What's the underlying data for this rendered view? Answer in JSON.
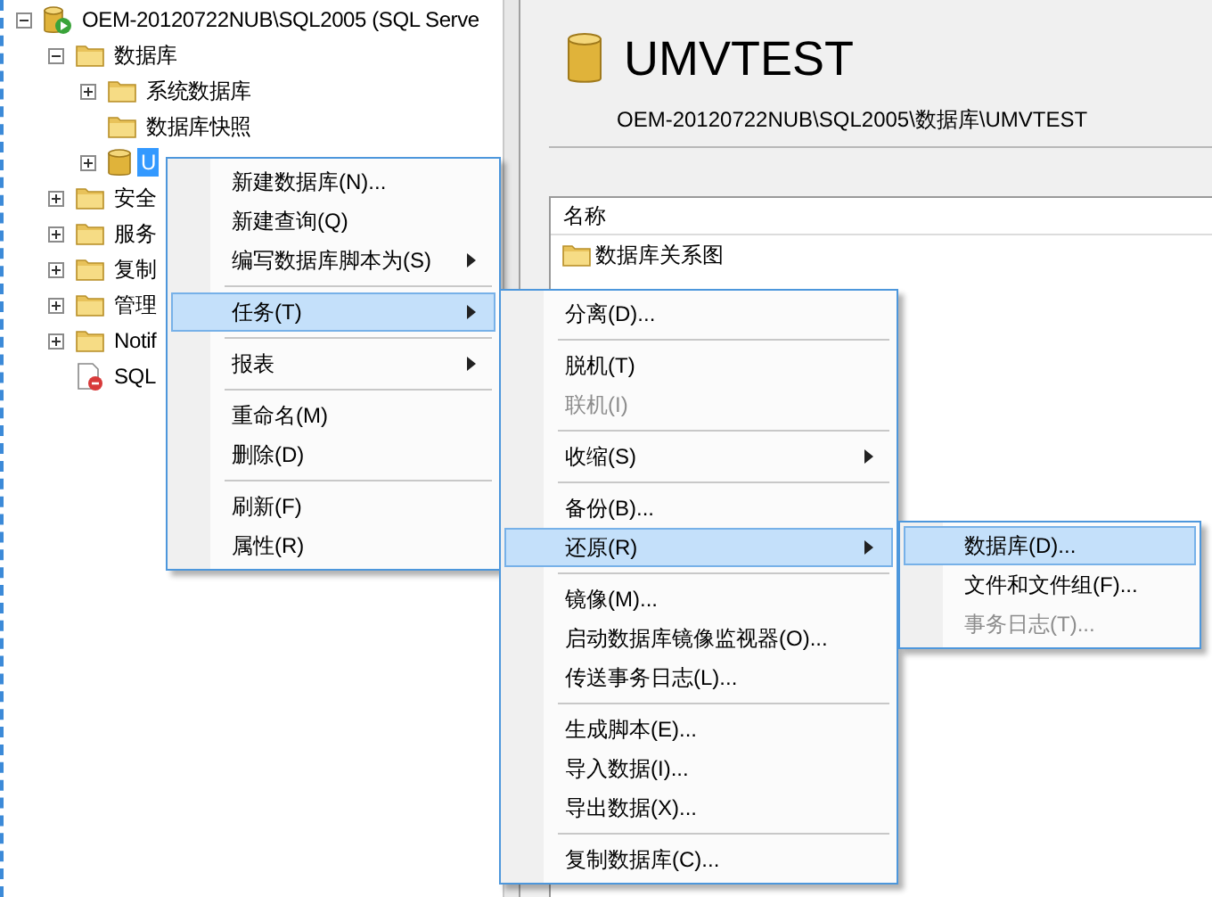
{
  "tree": [
    {
      "label": "OEM-20120722NUB\\SQL2005 (SQL Serve",
      "kind": "server",
      "expandable": true,
      "expanded": true,
      "selected": false,
      "children": [
        {
          "label": "数据库",
          "kind": "folder",
          "expandable": true,
          "expanded": true,
          "selected": false,
          "children": [
            {
              "label": "系统数据库",
              "kind": "folder",
              "expandable": true,
              "expanded": false,
              "selected": false
            },
            {
              "label": "数据库快照",
              "kind": "folder",
              "expandable": false,
              "selected": false
            },
            {
              "label": "U",
              "kind": "database",
              "expandable": true,
              "expanded": false,
              "selected": true
            }
          ]
        },
        {
          "label": "安全",
          "kind": "folder",
          "expandable": true,
          "expanded": false,
          "selected": false
        },
        {
          "label": "服务",
          "kind": "folder",
          "expandable": true,
          "expanded": false,
          "selected": false
        },
        {
          "label": "复制",
          "kind": "folder",
          "expandable": true,
          "expanded": false,
          "selected": false
        },
        {
          "label": "管理",
          "kind": "folder",
          "expandable": true,
          "expanded": false,
          "selected": false
        },
        {
          "label": "Notif",
          "kind": "folder",
          "expandable": true,
          "expanded": false,
          "selected": false
        },
        {
          "label": "SQL",
          "kind": "agent",
          "expandable": false,
          "selected": false
        }
      ]
    }
  ],
  "details": {
    "title": "UMVTEST",
    "path": "OEM-20120722NUB\\SQL2005\\数据库\\UMVTEST",
    "column_1": "名称",
    "rows": [
      {
        "label": "数据库关系图"
      }
    ]
  },
  "menus": [
    {
      "items": [
        {
          "kind": "item",
          "label": "新建数据库(N)...",
          "submenu": false,
          "selected": false,
          "disabled": false
        },
        {
          "kind": "item",
          "label": "新建查询(Q)",
          "submenu": false,
          "selected": false,
          "disabled": false
        },
        {
          "kind": "item",
          "label": "编写数据库脚本为(S)",
          "submenu": true,
          "selected": false,
          "disabled": false
        },
        {
          "kind": "separator"
        },
        {
          "kind": "item",
          "label": "任务(T)",
          "submenu": true,
          "selected": true,
          "disabled": false
        },
        {
          "kind": "separator"
        },
        {
          "kind": "item",
          "label": "报表",
          "submenu": true,
          "selected": false,
          "disabled": false
        },
        {
          "kind": "separator"
        },
        {
          "kind": "item",
          "label": "重命名(M)",
          "submenu": false,
          "selected": false,
          "disabled": false
        },
        {
          "kind": "item",
          "label": "删除(D)",
          "submenu": false,
          "selected": false,
          "disabled": false
        },
        {
          "kind": "separator"
        },
        {
          "kind": "item",
          "label": "刷新(F)",
          "submenu": false,
          "selected": false,
          "disabled": false
        },
        {
          "kind": "item",
          "label": "属性(R)",
          "submenu": false,
          "selected": false,
          "disabled": false
        }
      ]
    },
    {
      "items": [
        {
          "kind": "item",
          "label": "分离(D)...",
          "submenu": false,
          "selected": false,
          "disabled": false
        },
        {
          "kind": "separator"
        },
        {
          "kind": "item",
          "label": "脱机(T)",
          "submenu": false,
          "selected": false,
          "disabled": false
        },
        {
          "kind": "item",
          "label": "联机(I)",
          "submenu": false,
          "selected": false,
          "disabled": true
        },
        {
          "kind": "separator"
        },
        {
          "kind": "item",
          "label": "收缩(S)",
          "submenu": true,
          "selected": false,
          "disabled": false
        },
        {
          "kind": "separator"
        },
        {
          "kind": "item",
          "label": "备份(B)...",
          "submenu": false,
          "selected": false,
          "disabled": false
        },
        {
          "kind": "item",
          "label": "还原(R)",
          "submenu": true,
          "selected": true,
          "disabled": false
        },
        {
          "kind": "separator"
        },
        {
          "kind": "item",
          "label": "镜像(M)...",
          "submenu": false,
          "selected": false,
          "disabled": false
        },
        {
          "kind": "item",
          "label": "启动数据库镜像监视器(O)...",
          "submenu": false,
          "selected": false,
          "disabled": false
        },
        {
          "kind": "item",
          "label": "传送事务日志(L)...",
          "submenu": false,
          "selected": false,
          "disabled": false
        },
        {
          "kind": "separator"
        },
        {
          "kind": "item",
          "label": "生成脚本(E)...",
          "submenu": false,
          "selected": false,
          "disabled": false
        },
        {
          "kind": "item",
          "label": "导入数据(I)...",
          "submenu": false,
          "selected": false,
          "disabled": false
        },
        {
          "kind": "item",
          "label": "导出数据(X)...",
          "submenu": false,
          "selected": false,
          "disabled": false
        },
        {
          "kind": "separator"
        },
        {
          "kind": "item",
          "label": "复制数据库(C)...",
          "submenu": false,
          "selected": false,
          "disabled": false
        }
      ]
    },
    {
      "items": [
        {
          "kind": "item",
          "label": "数据库(D)...",
          "submenu": false,
          "selected": true,
          "disabled": false
        },
        {
          "kind": "item",
          "label": "文件和文件组(F)...",
          "submenu": false,
          "selected": false,
          "disabled": false
        },
        {
          "kind": "item",
          "label": "事务日志(T)...",
          "submenu": false,
          "selected": false,
          "disabled": true
        }
      ]
    }
  ]
}
